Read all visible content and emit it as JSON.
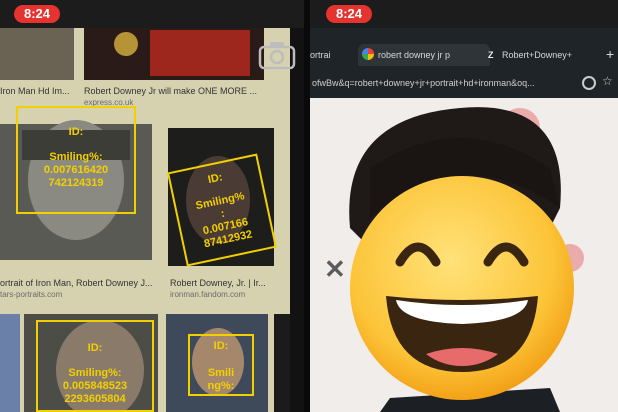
{
  "left_screen": {
    "status_time": "8:24",
    "top_captions": {
      "left": "Iron Man Hd Im...",
      "right": "Robert Downey Jr will make ONE MORE ...",
      "right_source": "express.co.uk"
    },
    "mid_captions": {
      "left": "ortrait of Iron Man, Robert Downey J...",
      "left_source": "tars-portraits.com",
      "right": "Robert Downey, Jr. | Ir...",
      "right_source": "ironman.fandom.com"
    },
    "face_boxes": [
      {
        "id_label": "ID:",
        "smiling_label": "Smiling%:",
        "value_line1": "0.007616420",
        "value_line2": "742124319"
      },
      {
        "id_label": "ID:",
        "smiling_label": "Smiling%",
        "value_line1": ":",
        "value_line2": "0.007166",
        "value_line3": "87412932"
      },
      {
        "id_label": "ID:",
        "smiling_label": "Smiling%:",
        "value_line1": "0.005848523",
        "value_line2": "2293605804"
      },
      {
        "id_label": "ID:",
        "smiling_label": "Smili",
        "value_line1": "ng%:"
      }
    ],
    "accent_color": "#f2d000"
  },
  "right_screen": {
    "status_time": "8:24",
    "tabs": [
      {
        "label": "ortrai"
      },
      {
        "label": "robert downey jr p"
      },
      {
        "label": "Robert+Downey+"
      }
    ],
    "url": "ofwBw&q=robert+downey+jr+portrait+hd+ironman&oq...",
    "overlay_icon": "grinning-emoji",
    "close_icon": "close-x-icon"
  }
}
